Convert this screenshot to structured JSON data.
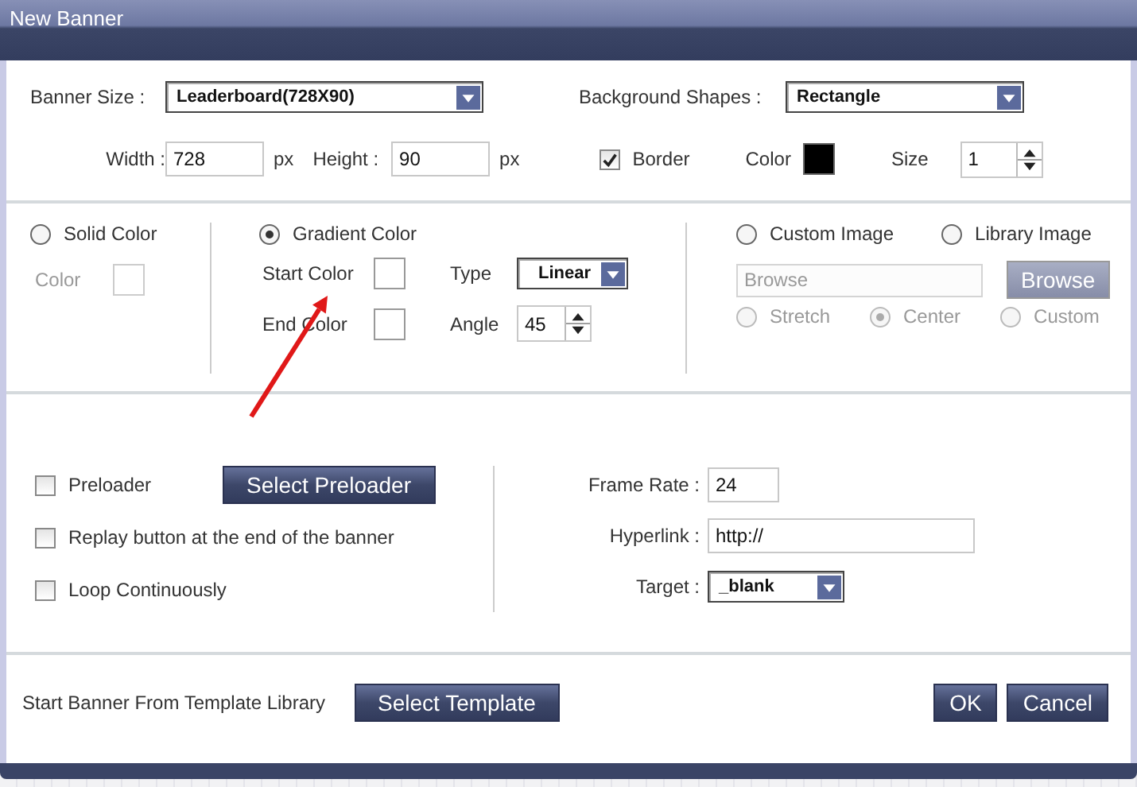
{
  "window": {
    "title": "New Banner"
  },
  "banner_size": {
    "label": "Banner Size :",
    "value": "Leaderboard(728X90)"
  },
  "background_shapes": {
    "label": "Background Shapes :",
    "value": "Rectangle"
  },
  "width": {
    "label": "Width :",
    "value": "728",
    "unit": "px"
  },
  "height": {
    "label": "Height :",
    "value": "90",
    "unit": "px"
  },
  "border": {
    "label": "Border",
    "checked": true
  },
  "border_color": {
    "label": "Color",
    "color": "#000000"
  },
  "border_size": {
    "label": "Size",
    "value": "1"
  },
  "solid": {
    "label": "Solid Color",
    "selected": false,
    "color_label": "Color",
    "disabled": true
  },
  "gradient": {
    "label": "Gradient Color",
    "selected": true,
    "start_label": "Start Color",
    "end_label": "End Color",
    "type_label": "Type",
    "type_value": "Linear",
    "angle_label": "Angle",
    "angle_value": "45"
  },
  "image": {
    "options": [
      {
        "label": "Custom Image",
        "selected": false
      },
      {
        "label": "Library Image",
        "selected": false
      }
    ],
    "browse_placeholder": "Browse",
    "browse_button": "Browse",
    "disabled": true,
    "positions": [
      {
        "label": "Stretch",
        "selected": false
      },
      {
        "label": "Center",
        "selected": true
      },
      {
        "label": "Custom",
        "selected": false
      }
    ]
  },
  "checkboxes": [
    {
      "label": "Preloader",
      "checked": false
    },
    {
      "label": "Replay button at the end of the banner",
      "checked": false
    },
    {
      "label": "Loop Continuously",
      "checked": false
    }
  ],
  "preloader_button": "Select Preloader",
  "frame_rate": {
    "label": "Frame Rate :",
    "value": "24"
  },
  "hyperlink": {
    "label": "Hyperlink :",
    "value": "http://"
  },
  "target": {
    "label": "Target :",
    "value": "_blank"
  },
  "template": {
    "label": "Start Banner From Template Library",
    "button": "Select Template"
  },
  "buttons": [
    "OK",
    "Cancel"
  ]
}
